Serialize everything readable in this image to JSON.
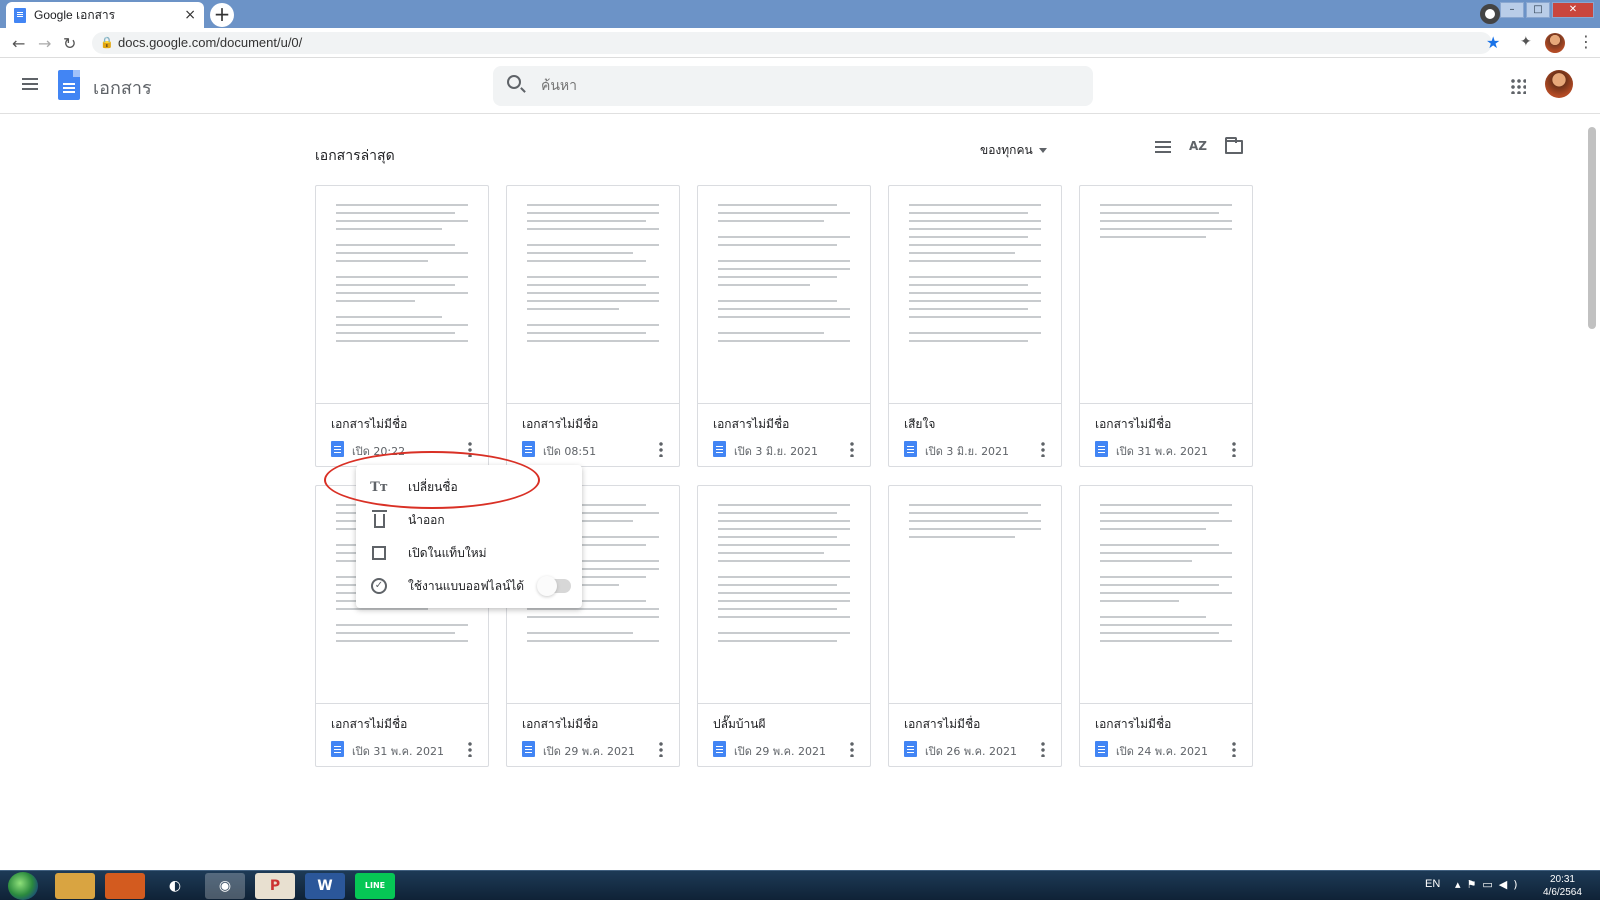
{
  "browser": {
    "tab_title": "Google เอกสาร",
    "tab_close": "×",
    "new_tab": "+",
    "url": "docs.google.com/document/u/0/"
  },
  "header": {
    "app_name": "เอกสาร",
    "search_placeholder": "ค้นหา"
  },
  "main": {
    "section_title": "เอกสารล่าสุด",
    "owner_filter": "ของทุกคน",
    "sort_icon_text": "AZ"
  },
  "documents": [
    {
      "title": "เอกสารไม่มีชื่อ",
      "date": "เปิด 20:22"
    },
    {
      "title": "เอกสารไม่มีชื่อ",
      "date": "เปิด 08:51"
    },
    {
      "title": "เอกสารไม่มีชื่อ",
      "date": "เปิด 3 มิ.ย. 2021"
    },
    {
      "title": "เสียใจ",
      "date": "เปิด 3 มิ.ย. 2021"
    },
    {
      "title": "เอกสารไม่มีชื่อ",
      "date": "เปิด 31 พ.ค. 2021"
    },
    {
      "title": "เอกสารไม่มีชื่อ",
      "date": "เปิด 31 พ.ค. 2021"
    },
    {
      "title": "เอกสารไม่มีชื่อ",
      "date": "เปิด 29 พ.ค. 2021"
    },
    {
      "title": "ปลั๊มบ้านผี",
      "date": "เปิด 29 พ.ค. 2021"
    },
    {
      "title": "เอกสารไม่มีชื่อ",
      "date": "เปิด 26 พ.ค. 2021"
    },
    {
      "title": "เอกสารไม่มีชื่อ",
      "date": "เปิด 24 พ.ค. 2021"
    }
  ],
  "context_menu": {
    "rename": "เปลี่ยนชื่อ",
    "remove": "นำออก",
    "open_new_tab": "เปิดในแท็บใหม่",
    "offline": "ใช้งานแบบออฟไลน์ได้",
    "rename_icon_text": "Tт",
    "offline_icon_text": "✓"
  },
  "taskbar": {
    "language": "EN",
    "time": "20:31",
    "date": "4/6/2564",
    "word_label": "W",
    "line_label": "LINE"
  },
  "colors": {
    "accent": "#4285f4",
    "highlight_ellipse": "#d93025"
  }
}
